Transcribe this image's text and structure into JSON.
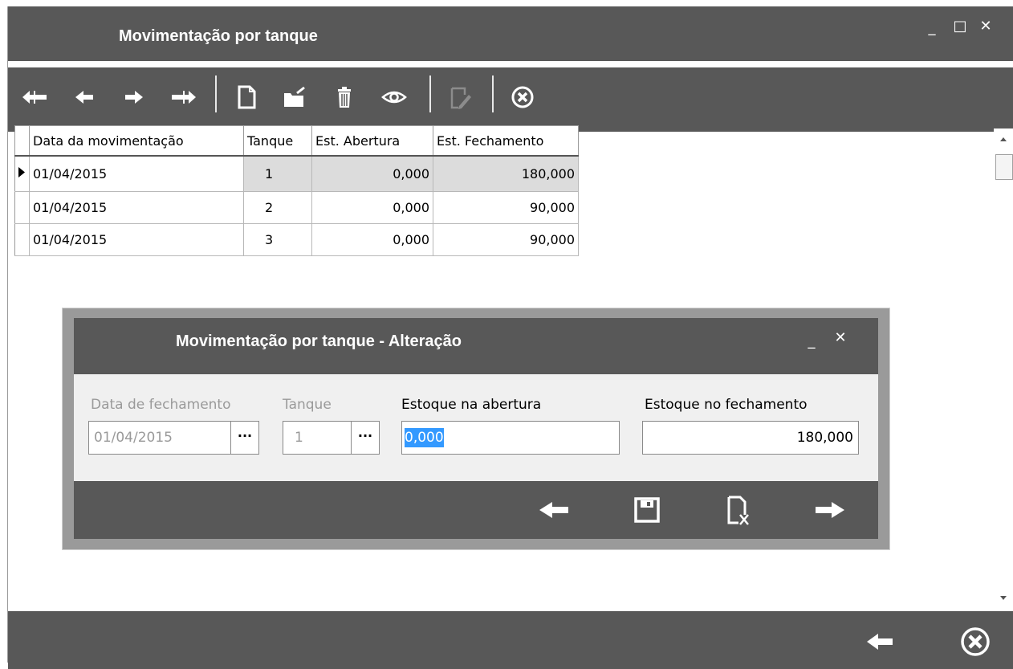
{
  "window": {
    "title": "Movimentação por tanque",
    "controls": {
      "minimize": "_",
      "maximize": "□",
      "close": "✕"
    }
  },
  "toolbar": {
    "icons": [
      "first-record-icon",
      "previous-record-icon",
      "next-record-icon",
      "last-record-icon",
      "new-record-icon",
      "open-folder-icon",
      "delete-icon",
      "view-icon",
      "edit-icon",
      "cancel-icon"
    ]
  },
  "grid": {
    "columns": [
      "Data da movimentação",
      "Tanque",
      "Est. Abertura",
      "Est. Fechamento"
    ],
    "rows": [
      {
        "date": "01/04/2015",
        "tank": "1",
        "opening": "0,000",
        "closing": "180,000"
      },
      {
        "date": "01/04/2015",
        "tank": "2",
        "opening": "0,000",
        "closing": "90,000"
      },
      {
        "date": "01/04/2015",
        "tank": "3",
        "opening": "0,000",
        "closing": "90,000"
      }
    ]
  },
  "dialog": {
    "title": "Movimentação por tanque - Alteração",
    "controls": {
      "minimize": "_",
      "close": "✕"
    },
    "fields": {
      "closing_date": {
        "label": "Data de fechamento",
        "value": "01/04/2015",
        "button": "···"
      },
      "tank": {
        "label": "Tanque",
        "value": "1",
        "button": "···"
      },
      "opening_stock": {
        "label": "Estoque na abertura",
        "value": "0,000"
      },
      "closing_stock": {
        "label": "Estoque no fechamento",
        "value": "180,000"
      }
    }
  },
  "colors": {
    "bar": "#585858",
    "selection": "#3399ff",
    "selected_row": "#dcdcdc"
  }
}
